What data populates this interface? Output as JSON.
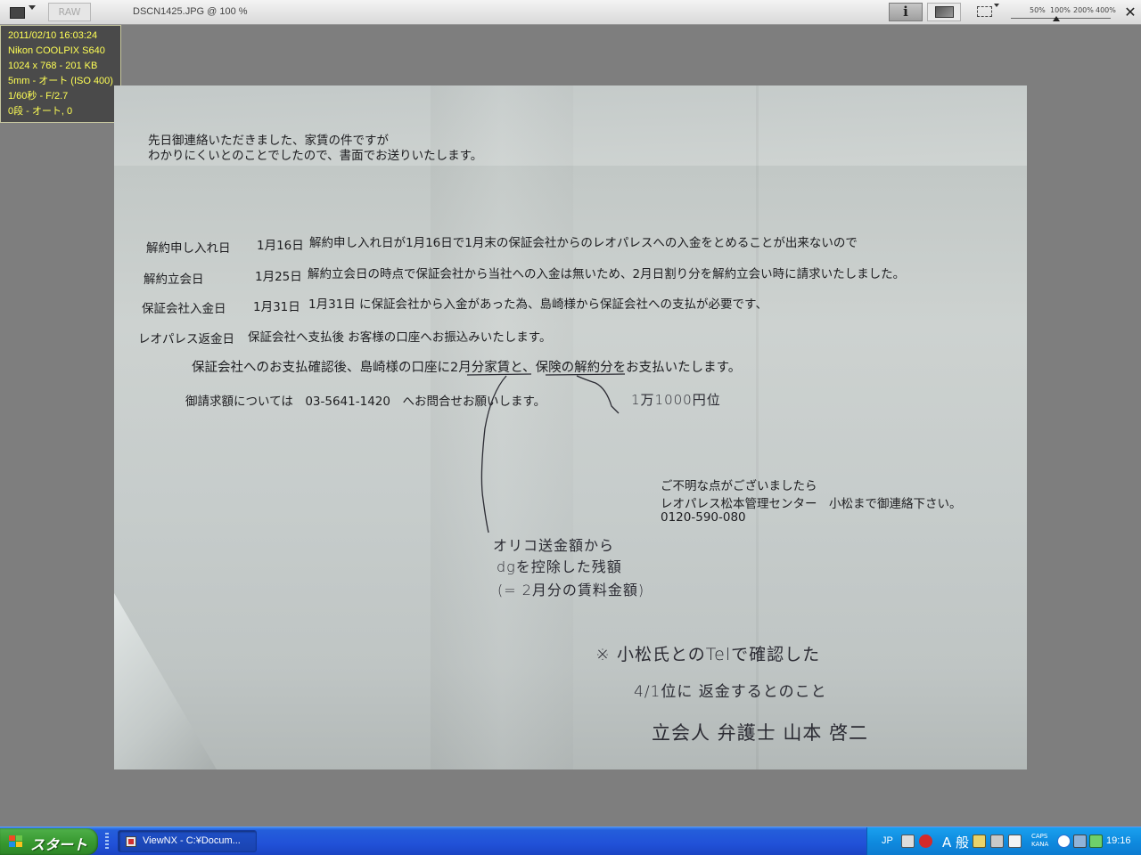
{
  "toolbar": {
    "raw_label": "RAW",
    "file_title": "DSCN1425.JPG @ 100 %",
    "info_label": "i",
    "zoom_levels": [
      "50%",
      "100%",
      "200%",
      "400%"
    ],
    "zoom_value": "100%",
    "close_label": "✕"
  },
  "info_panel": {
    "lines": [
      "2011/02/10 16:03:24",
      "Nikon COOLPIX S640",
      "1024 x 768 - 201 KB",
      "5mm - オート (ISO 400)",
      "1/60秒 - F/2.7",
      "0段 - オート, 0"
    ]
  },
  "document": {
    "intro": [
      "先日御連絡いただきました、家賃の件ですが",
      "わかりにくいとのことでしたので、書面でお送りいたします。"
    ],
    "rows": [
      {
        "label": "解約申し入れ日",
        "date": "1月16日",
        "text": "解約申し入れ日が1月16日で1月末の保証会社からのレオパレスへの入金をとめることが出来ないので"
      },
      {
        "label": "解約立会日",
        "date": "1月25日",
        "text": "解約立会日の時点で保証会社から当社への入金は無いため、2月日割り分を解約立会い時に請求いたしました。"
      },
      {
        "label": "保証会社入金日",
        "date": "1月31日",
        "text": "1月31日 に保証会社から入金があった為、島崎様から保証会社への支払が必要です、"
      },
      {
        "label": "レオパレス返金日",
        "date": "",
        "text": "保証会社へ支払後 お客様の口座へお振込みいたします。"
      }
    ],
    "payment_line": "保証会社へのお支払確認後、島崎様の口座に2月分家賃と、保険の解約分をお支払いたします。",
    "billing_line": "御請求額については　03-5641-1420　へお問合せお願いします。",
    "contact": [
      "ご不明な点がございましたら",
      "レオパレス松本管理センター　小松まで御連絡下さい。",
      "0120-590-080"
    ],
    "handwritten": {
      "note_amount": "1万1000円位",
      "note_deduction": [
        "オリコ送金額から",
        "dgを控除した残額",
        "(= 2月分の賃料金額)"
      ],
      "note_confirm": [
        "※ 小松氏とのTelで確認した",
        "4/1位に 返金するとのこと",
        "立会人 弁護士 山本 啓二"
      ]
    }
  },
  "taskbar": {
    "start_label": "スタート",
    "task_label": "ViewNX - C:¥Docum...",
    "tray_lang": "JP",
    "tray_ime": "A 般",
    "tray_caps": [
      "CAPS",
      "KANA"
    ],
    "time": "19:16"
  },
  "colors": {
    "info_text": "#ffff55",
    "taskbar_blue": "#245edb",
    "start_green": "#37982f",
    "tray_blue": "#0f8bdf"
  }
}
